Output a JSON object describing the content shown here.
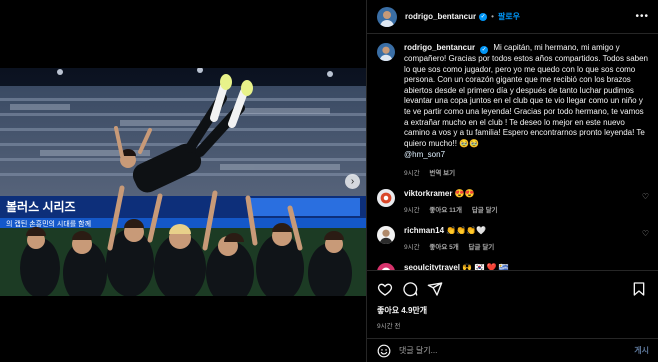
{
  "post_author": {
    "username": "rodrigo_bentancur",
    "follow_label": "팔로우",
    "separator": "•"
  },
  "caption": {
    "username": "rodrigo_bentancur",
    "text": "Mi capitán, mi hermano, mi amigo y compañero! Gracias por todos estos años compartidos. Todos saben lo que sos como jugador, pero yo me quedo con lo que sos como persona. Con un corazón gigante que me recibió con los brazos abiertos desde el primero día y después de tanto luchar pudimos levantar una copa juntos en el club que te vio llegar como un niño y te ve partir como una leyenda! Gracias por todo hermano, te vamos a extrañar mucho en el club ! Te deseo lo mejor en este nuevo camino a vos y a tu familia! Espero encontrarnos pronto leyenda! Te quiero mucho!! 🥹🥹",
    "mention": "@hm_son7",
    "time": "9시간",
    "translate": "번역 보기"
  },
  "comments": [
    {
      "username": "viktorkramer",
      "text": "😍😍",
      "time": "9시간",
      "likes": "좋아요 11개",
      "reply": "답글 달기"
    },
    {
      "username": "richman14",
      "text": "👏👏👏🤍",
      "time": "9시간",
      "likes": "좋아요 5개",
      "reply": "답글 달기"
    },
    {
      "username": "seoulcitytravel",
      "text": "🙌 🇰🇷 ❤️ 🇺🇾",
      "time": "",
      "likes": "",
      "reply": ""
    }
  ],
  "actions": {
    "likes": "좋아요 4.9만개",
    "time_ago": "9시간 전"
  },
  "add_comment": {
    "placeholder": "댓글 달기...",
    "post_label": "게시"
  },
  "media": {
    "banner_text": "볼러스 시리즈",
    "banner_text_2": "의 캡틴 손흥민의 시대를 함께",
    "next_icon": "chevron-right-icon"
  },
  "colors": {
    "accent": "#0095f6",
    "background": "#000000",
    "muted": "#a8a8a8"
  }
}
